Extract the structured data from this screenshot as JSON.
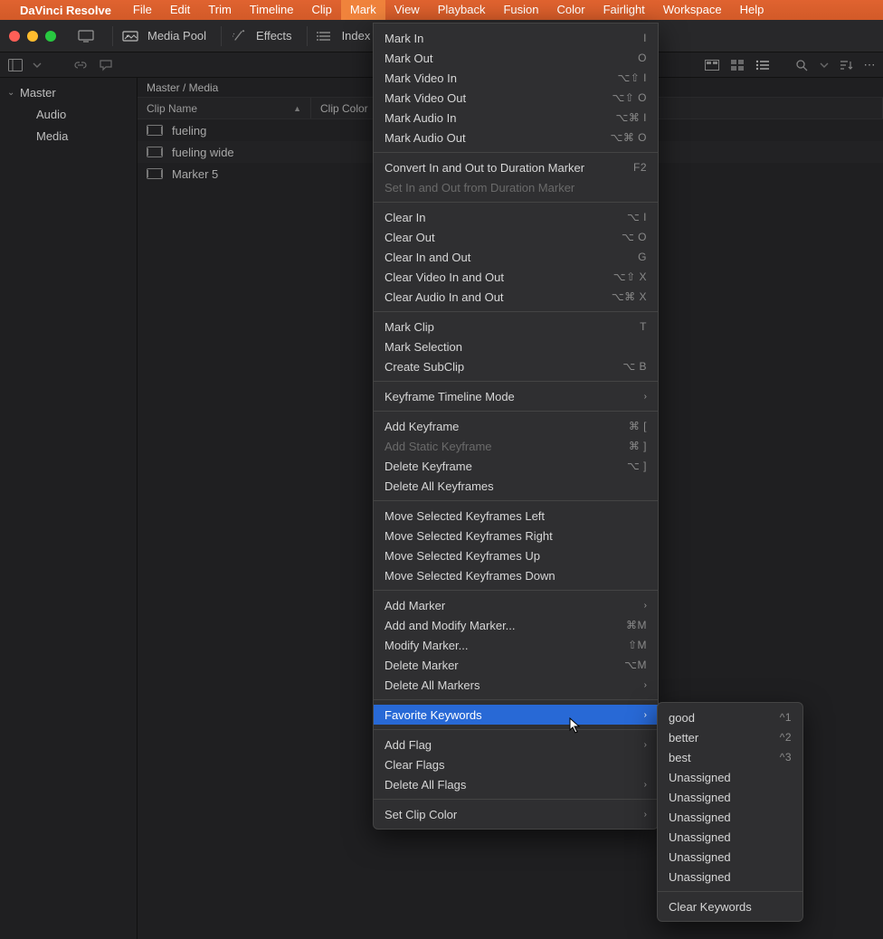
{
  "menubar": {
    "app_name": "DaVinci Resolve",
    "items": [
      "File",
      "Edit",
      "Trim",
      "Timeline",
      "Clip",
      "Mark",
      "View",
      "Playback",
      "Fusion",
      "Color",
      "Fairlight",
      "Workspace",
      "Help"
    ],
    "active_index": 5
  },
  "toolbar": {
    "media_pool": "Media Pool",
    "effects": "Effects",
    "index": "Index"
  },
  "sidebar": {
    "root": "Master",
    "children": [
      "Audio",
      "Media"
    ]
  },
  "breadcrumb": "Master / Media",
  "columns": {
    "name": "Clip Name",
    "color": "Clip Color"
  },
  "clips": [
    "fueling",
    "fueling wide",
    "Marker 5"
  ],
  "mark_menu": {
    "groups": [
      [
        {
          "label": "Mark In",
          "shortcut": "I"
        },
        {
          "label": "Mark Out",
          "shortcut": "O"
        },
        {
          "label": "Mark Video In",
          "shortcut": "⌥⇧ I"
        },
        {
          "label": "Mark Video Out",
          "shortcut": "⌥⇧ O"
        },
        {
          "label": "Mark Audio In",
          "shortcut": "⌥⌘ I"
        },
        {
          "label": "Mark Audio Out",
          "shortcut": "⌥⌘ O"
        }
      ],
      [
        {
          "label": "Convert In and Out to Duration Marker",
          "shortcut": "F2"
        },
        {
          "label": "Set In and Out from Duration Marker",
          "disabled": true
        }
      ],
      [
        {
          "label": "Clear In",
          "shortcut": "⌥ I"
        },
        {
          "label": "Clear Out",
          "shortcut": "⌥ O"
        },
        {
          "label": "Clear In and Out",
          "shortcut": "G"
        },
        {
          "label": "Clear Video In and Out",
          "shortcut": "⌥⇧ X"
        },
        {
          "label": "Clear Audio In and Out",
          "shortcut": "⌥⌘ X"
        }
      ],
      [
        {
          "label": "Mark Clip",
          "shortcut": "T"
        },
        {
          "label": "Mark Selection"
        },
        {
          "label": "Create SubClip",
          "shortcut": "⌥ B"
        }
      ],
      [
        {
          "label": "Keyframe Timeline Mode",
          "submenu": true
        }
      ],
      [
        {
          "label": "Add Keyframe",
          "shortcut": "⌘ ["
        },
        {
          "label": "Add Static Keyframe",
          "shortcut": "⌘ ]",
          "disabled": true
        },
        {
          "label": "Delete Keyframe",
          "shortcut": "⌥ ]"
        },
        {
          "label": "Delete All Keyframes"
        }
      ],
      [
        {
          "label": "Move Selected Keyframes Left"
        },
        {
          "label": "Move Selected Keyframes Right"
        },
        {
          "label": "Move Selected Keyframes Up"
        },
        {
          "label": "Move Selected Keyframes Down"
        }
      ],
      [
        {
          "label": "Add Marker",
          "submenu": true
        },
        {
          "label": "Add and Modify Marker...",
          "shortcut": "⌘M"
        },
        {
          "label": "Modify Marker...",
          "shortcut": "⇧M"
        },
        {
          "label": "Delete Marker",
          "shortcut": "⌥M"
        },
        {
          "label": "Delete All Markers",
          "submenu": true
        }
      ],
      [
        {
          "label": "Favorite Keywords",
          "submenu": true,
          "highlighted": true
        }
      ],
      [
        {
          "label": "Add Flag",
          "submenu": true
        },
        {
          "label": "Clear Flags"
        },
        {
          "label": "Delete All Flags",
          "submenu": true
        }
      ],
      [
        {
          "label": "Set Clip Color",
          "submenu": true
        }
      ]
    ]
  },
  "keywords_submenu": {
    "groups": [
      [
        {
          "label": "good",
          "shortcut": "^1"
        },
        {
          "label": "better",
          "shortcut": "^2"
        },
        {
          "label": "best",
          "shortcut": "^3"
        },
        {
          "label": "Unassigned"
        },
        {
          "label": "Unassigned"
        },
        {
          "label": "Unassigned"
        },
        {
          "label": "Unassigned"
        },
        {
          "label": "Unassigned"
        },
        {
          "label": "Unassigned"
        }
      ],
      [
        {
          "label": "Clear Keywords"
        }
      ]
    ]
  }
}
